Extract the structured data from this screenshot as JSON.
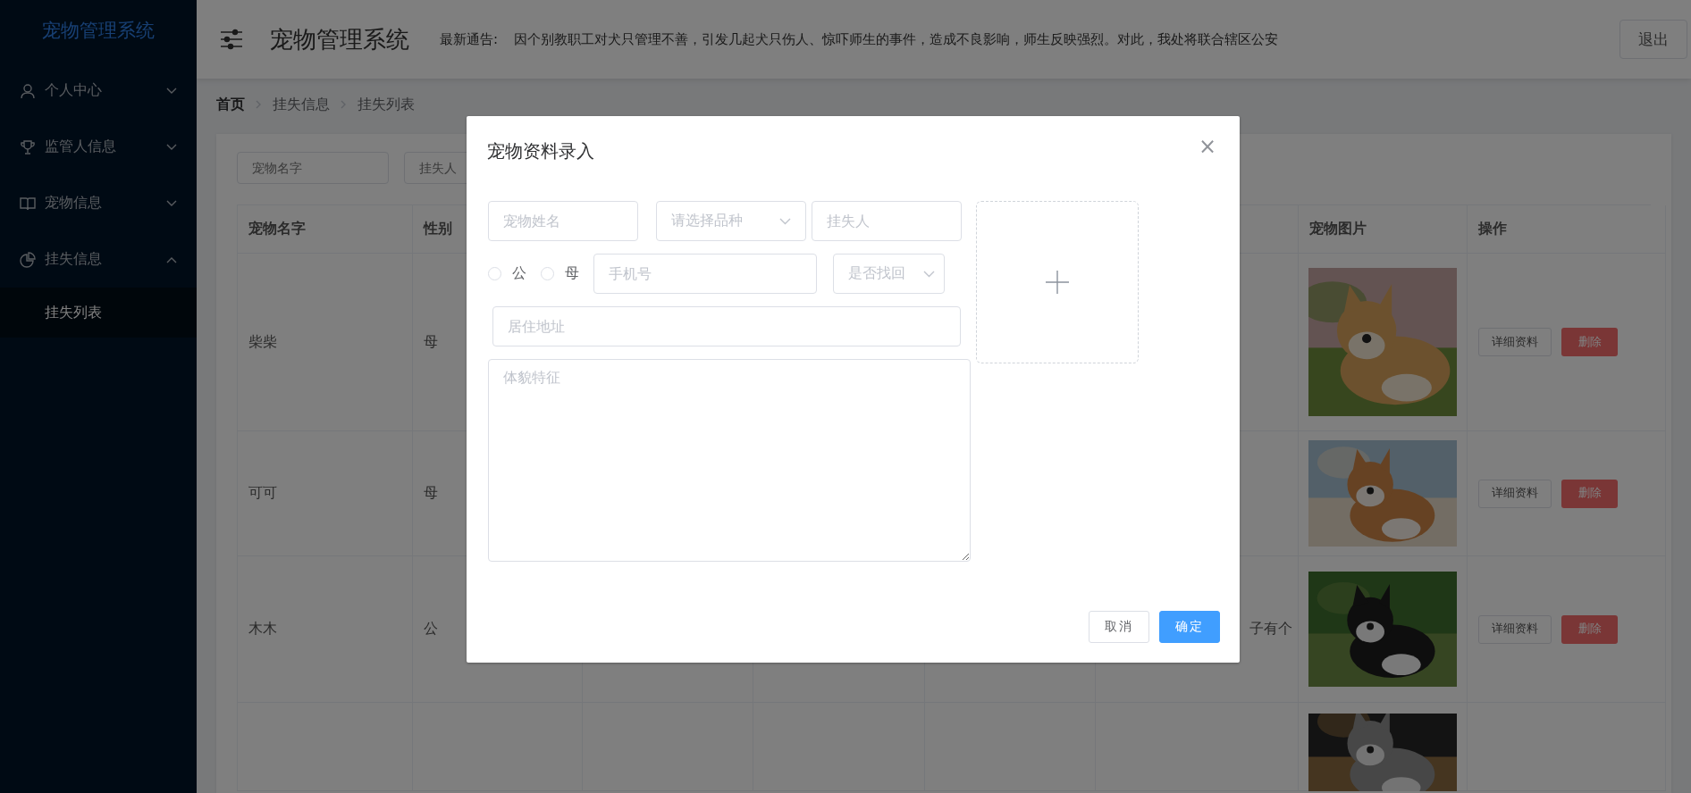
{
  "sidebar": {
    "title": "宠物管理系统",
    "items": [
      {
        "label": "个人中心",
        "expanded": false
      },
      {
        "label": "监管人信息",
        "expanded": false
      },
      {
        "label": "宠物信息",
        "expanded": false
      },
      {
        "label": "挂失信息",
        "expanded": true,
        "children": [
          {
            "label": "挂失列表",
            "selected": true
          }
        ]
      }
    ]
  },
  "header": {
    "title": "宠物管理系统",
    "notice_label": "最新通告:",
    "notice": "因个别教职工对犬只管理不善，引发几起犬只伤人、惊吓师生的事件，造成不良影响，师生反映强烈。对此，我处将联合辖区公安",
    "logout": "退出"
  },
  "breadcrumb": [
    {
      "label": "首页",
      "kind": "link"
    },
    {
      "label": "挂失信息",
      "kind": "text"
    },
    {
      "label": "挂失列表",
      "kind": "text"
    }
  ],
  "filters": [
    {
      "placeholder": "宠物名字"
    },
    {
      "placeholder": "挂失人"
    }
  ],
  "table": {
    "columns": {
      "name": "宠物名字",
      "sex": "性别",
      "picture": "宠物图片",
      "actions": "操作"
    },
    "rows": [
      {
        "name": "柴柴",
        "sex": "母",
        "picture": {
          "kind": "picture"
        },
        "actions": [
          "详细资料",
          "删除"
        ]
      },
      {
        "name": "可可",
        "sex": "母",
        "picture": {
          "kind": "picture"
        },
        "actions": [
          "详细资料",
          "删除"
        ]
      },
      {
        "name": "木木",
        "sex": "公",
        "column_6": "子有个",
        "picture": {
          "kind": "picture"
        },
        "actions": [
          "详细资料",
          "删除"
        ]
      },
      {
        "picture": {
          "kind": "picture"
        }
      }
    ]
  },
  "dialog": {
    "title": "宠物资料录入",
    "close": "×",
    "form_rows": [
      {
        "items": [
          {
            "kind": "input",
            "placeholder": "宠物姓名"
          },
          {
            "kind": "select",
            "placeholder": "请选择品种"
          },
          {
            "kind": "input",
            "placeholder": "挂失人"
          }
        ]
      },
      {
        "items": [
          {
            "kind": "radio",
            "label": "公",
            "selected": false
          },
          {
            "kind": "radio",
            "label": "母",
            "selected": false
          },
          {
            "kind": "input",
            "placeholder": "手机号"
          },
          {
            "kind": "select",
            "placeholder": "是否找回"
          }
        ]
      },
      {
        "items": [
          {
            "kind": "input",
            "placeholder": "居住地址"
          }
        ]
      },
      {
        "items": [
          {
            "kind": "textarea",
            "placeholder": "体貌特征"
          }
        ]
      }
    ],
    "upload": {
      "kind": "upload"
    },
    "buttons": [
      {
        "label": "取消",
        "kind": "default"
      },
      {
        "label": "确定",
        "kind": "primary"
      }
    ]
  }
}
